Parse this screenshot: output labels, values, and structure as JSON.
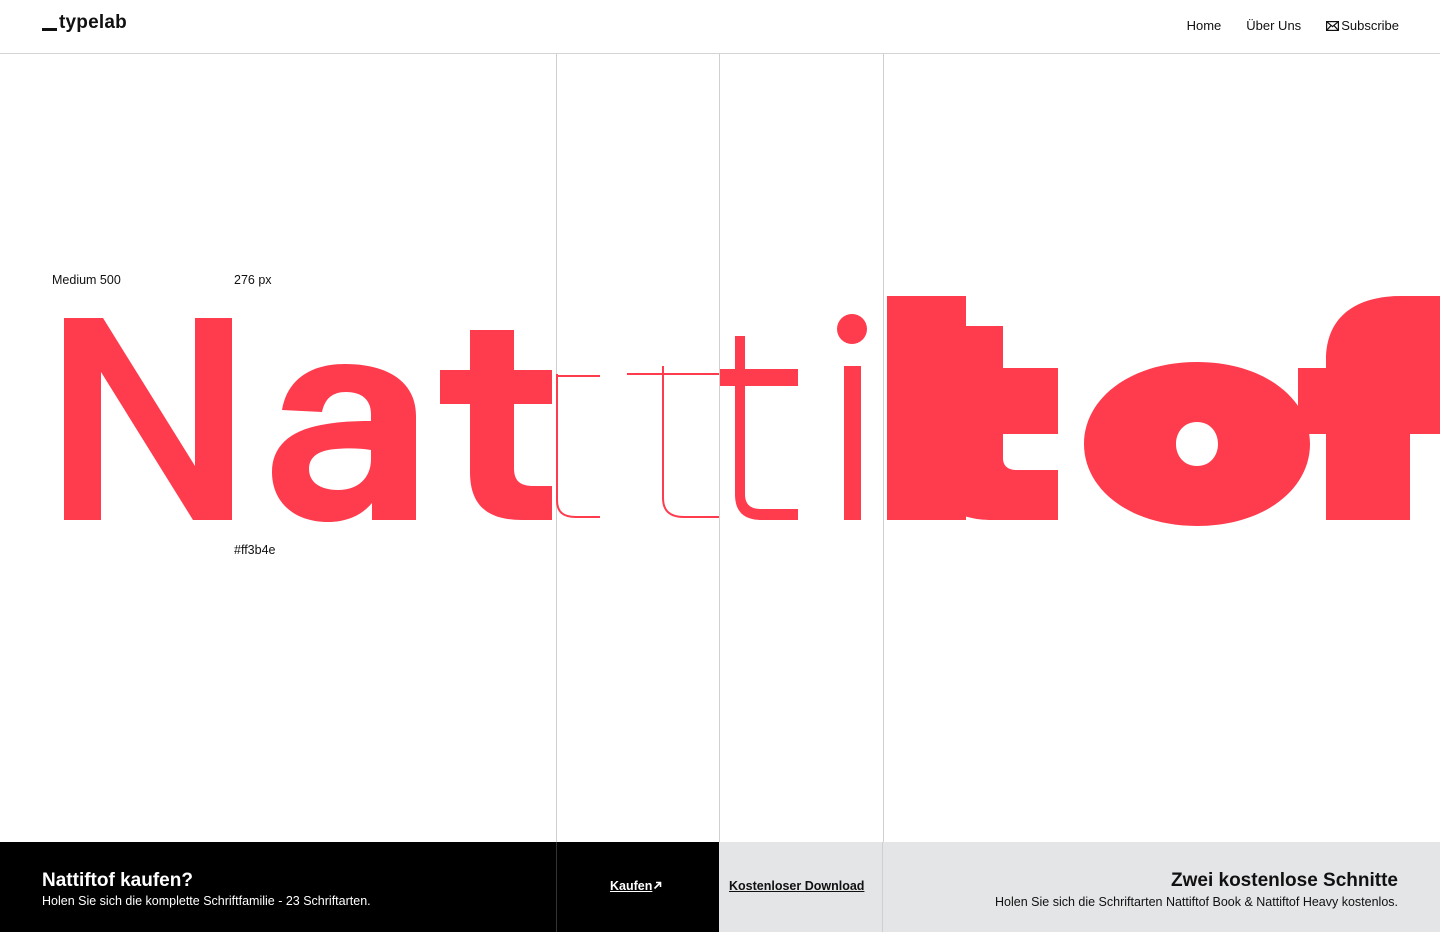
{
  "brand": {
    "logo_text": "typelab"
  },
  "nav": {
    "items": [
      {
        "label": "Home"
      },
      {
        "label": "Über Uns"
      },
      {
        "label": "Subscribe",
        "icon": "mail-icon"
      }
    ]
  },
  "specimen": {
    "weight_label": "Medium 500",
    "size_label": "276 px",
    "color_label": "#ff3b4e",
    "word": "Nattiftof",
    "accent_color": "#ff3b4e"
  },
  "buy": {
    "title": "Nattiftof kaufen?",
    "subtitle": "Holen Sie sich die komplette Schriftfamilie - 23 Schriftarten.",
    "link_label": "Kaufen",
    "link_icon": "arrow-up-right-icon"
  },
  "free": {
    "link_label": "Kostenloser Download",
    "title": "Zwei kostenlose Schnitte",
    "subtitle": "Holen Sie sich die Schriftarten Nattiftof Book & Nattiftof Heavy kostenlos."
  }
}
